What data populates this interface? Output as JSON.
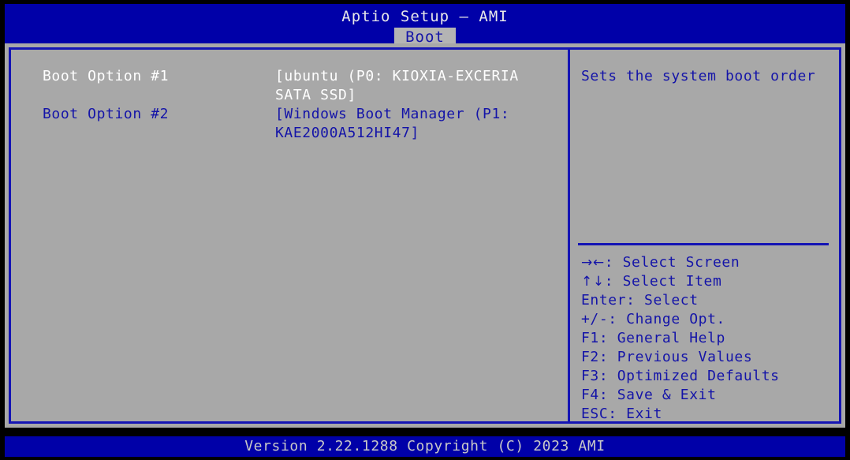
{
  "header": {
    "title": "Aptio Setup – AMI",
    "tabs": [
      {
        "label": "Boot",
        "active": true
      }
    ]
  },
  "main": {
    "options": [
      {
        "label": "Boot Option #1",
        "value": "[ubuntu (P0: KIOXIA-EXCERIA SATA SSD]",
        "selected": true
      },
      {
        "label": "Boot Option #2",
        "value": "[Windows Boot Manager (P1: KAE2000A512HI47]",
        "selected": false
      }
    ]
  },
  "help": {
    "description": "Sets the system boot order",
    "key_legend": [
      {
        "glyph": "→←",
        "text": ": Select Screen"
      },
      {
        "glyph": "↑↓",
        "text": ": Select Item"
      },
      {
        "glyph": "",
        "text": "Enter: Select"
      },
      {
        "glyph": "",
        "text": "+/-: Change Opt."
      },
      {
        "glyph": "",
        "text": "F1: General Help"
      },
      {
        "glyph": "",
        "text": "F2: Previous Values"
      },
      {
        "glyph": "",
        "text": "F3: Optimized Defaults"
      },
      {
        "glyph": "",
        "text": "F4: Save & Exit"
      },
      {
        "glyph": "",
        "text": "ESC: Exit"
      }
    ]
  },
  "footer": {
    "version_text": "Version 2.22.1288 Copyright (C) 2023 AMI"
  },
  "colors": {
    "header_blue": "#0000a8",
    "panel_gray": "#a8a8a8",
    "border_blue": "#1414b4",
    "text_blue": "#1414a8",
    "text_white": "#ffffff",
    "tab_gray": "#b4b4b4",
    "footer_text": "#c8c8c8"
  }
}
